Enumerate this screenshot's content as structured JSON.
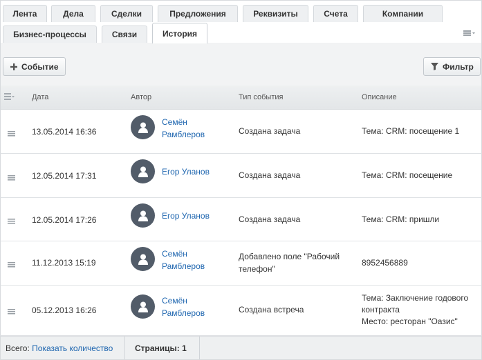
{
  "tabs": [
    {
      "label": "Лента",
      "active": false
    },
    {
      "label": "Дела",
      "active": false
    },
    {
      "label": "Сделки",
      "active": false
    },
    {
      "label": "Предложения",
      "active": false
    },
    {
      "label": "Реквизиты",
      "active": false
    },
    {
      "label": "Счета",
      "active": false
    },
    {
      "label": "Компании",
      "active": false
    },
    {
      "label": "Бизнес-процессы",
      "active": false
    },
    {
      "label": "Связи",
      "active": false
    },
    {
      "label": "История",
      "active": true
    }
  ],
  "toolbar": {
    "event_button": "Событие",
    "filter_button": "Фильтр"
  },
  "grid": {
    "headers": {
      "date": "Дата",
      "author": "Автор",
      "event_type": "Тип события",
      "description": "Описание"
    },
    "rows": [
      {
        "date": "13.05.2014 16:36",
        "author_line1": "Семён",
        "author_line2": "Рамблеров",
        "event_type_line1": "Создана задача",
        "event_type_line2": "",
        "desc_line1": "Тема: CRM: посещение 1",
        "desc_line2": "",
        "desc_line3": ""
      },
      {
        "date": "12.05.2014 17:31",
        "author_line1": "Егор Уланов",
        "author_line2": "",
        "event_type_line1": "Создана задача",
        "event_type_line2": "",
        "desc_line1": "Тема: CRM: посещение",
        "desc_line2": "",
        "desc_line3": ""
      },
      {
        "date": "12.05.2014 17:26",
        "author_line1": "Егор Уланов",
        "author_line2": "",
        "event_type_line1": "Создана задача",
        "event_type_line2": "",
        "desc_line1": "Тема: CRM: пришли",
        "desc_line2": "",
        "desc_line3": ""
      },
      {
        "date": "11.12.2013 15:19",
        "author_line1": "Семён",
        "author_line2": "Рамблеров",
        "event_type_line1": "Добавлено поле \"Рабочий",
        "event_type_line2": "телефон\"",
        "desc_line1": "8952456889",
        "desc_line2": "",
        "desc_line3": ""
      },
      {
        "date": "05.12.2013 16:26",
        "author_line1": "Семён",
        "author_line2": "Рамблеров",
        "event_type_line1": "Создана встреча",
        "event_type_line2": "",
        "desc_line1": "Тема: Заключение годового",
        "desc_line2": "контракта",
        "desc_line3": "Место: ресторан \"Оазис\""
      }
    ]
  },
  "footer": {
    "total_label": "Всего:",
    "show_count_link": "Показать количество",
    "pages_label": "Страницы: 1"
  },
  "colors": {
    "link": "#2067b0",
    "avatar_bg": "#525c69"
  }
}
